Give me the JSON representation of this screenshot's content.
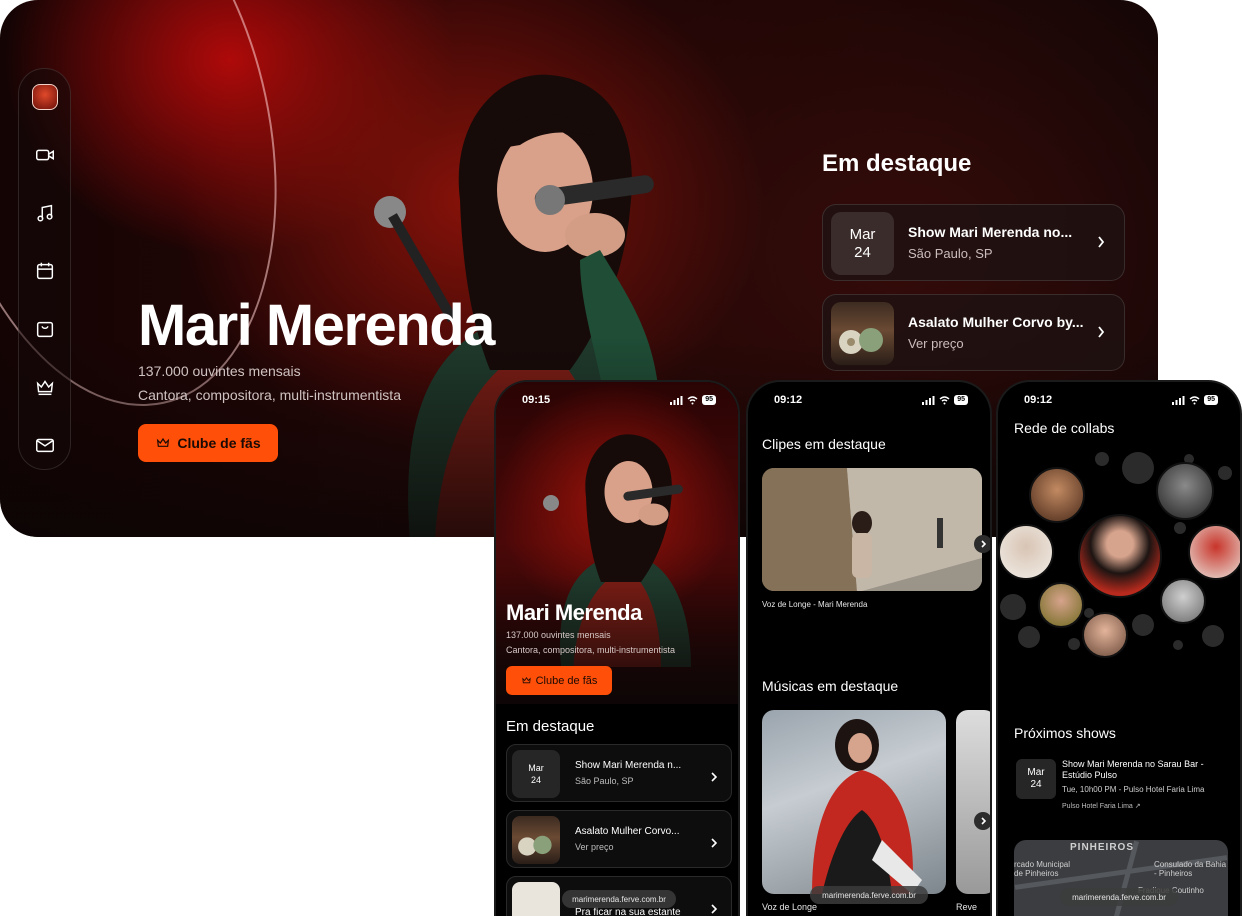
{
  "desktop": {
    "artist_name": "Mari Merenda",
    "listeners": "137.000 ouvintes mensais",
    "description": "Cantora, compositora, multi-instrumentista",
    "fan_club_label": "Clube de fãs",
    "featured_title": "Em destaque",
    "featured": [
      {
        "month": "Mar",
        "day": "24",
        "title": "Show Mari Merenda no...",
        "meta": "São Paulo, SP"
      },
      {
        "title": "Asalato Mulher Corvo by...",
        "meta": "Ver preço"
      }
    ],
    "sidebar_icons": [
      "video-icon",
      "music-icon",
      "calendar-icon",
      "shopping-bag-icon",
      "crown-icon",
      "mail-icon"
    ]
  },
  "phone1": {
    "time": "09:15",
    "battery": "95",
    "artist_name": "Mari Merenda",
    "listeners": "137.000 ouvintes mensais",
    "description": "Cantora, compositora, multi-instrumentista",
    "fan_club_label": "Clube de fãs",
    "featured_title": "Em destaque",
    "featured": [
      {
        "month": "Mar",
        "day": "24",
        "title": "Show Mari Merenda n...",
        "meta": "São Paulo, SP"
      },
      {
        "title": "Asalato Mulher Corvo...",
        "meta": "Ver preço"
      },
      {
        "title": "Pra ficar na sua estante"
      }
    ],
    "url": "marimerenda.ferve.com.br"
  },
  "phone2": {
    "time": "09:12",
    "battery": "95",
    "clips_title": "Clipes em destaque",
    "clip_caption": "Voz de Longe - Mari Merenda",
    "songs_title": "Músicas em destaque",
    "song_caption": "Voz de Longe",
    "song_caption_2": "Reve",
    "url": "marimerenda.ferve.com.br"
  },
  "phone3": {
    "time": "09:12",
    "battery": "95",
    "collabs_title": "Rede de collabs",
    "shows_title": "Próximos shows",
    "show": {
      "month": "Mar",
      "day": "24",
      "title": "Show Mari Merenda no Sarau Bar - Estúdio Pulso",
      "details": "Tue, 10h00 PM - Pulso Hotel Faria Lima",
      "venue_link": "Pulso Hotel Faria Lima ↗"
    },
    "map_labels": {
      "district": "PINHEIROS",
      "consulate": "Consulado da Bahia - Pinheiros",
      "market": "rcado Municipal de Pinheiros",
      "place": "Fradique Coutinho"
    },
    "url": "marimerenda.ferve.com.br"
  },
  "colors": {
    "accent": "#ff4f08",
    "background": "#000000"
  }
}
